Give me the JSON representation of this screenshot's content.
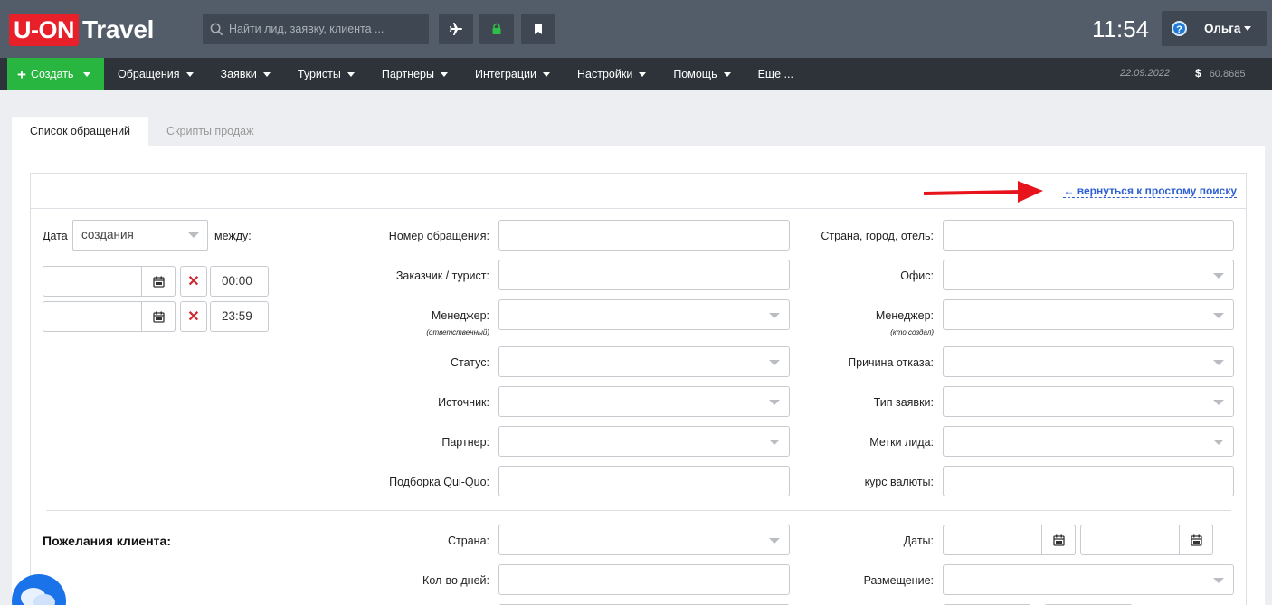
{
  "header": {
    "logo_brand": "U-ON",
    "logo_suffix": "Travel",
    "search_placeholder": "Найти лид, заявку, клиента ...",
    "clock": "11:54",
    "user_name": "Ольга",
    "user_icon_glyph": "?",
    "icons": [
      "search-icon",
      "airplane-icon",
      "lock-icon",
      "bookmark-icon",
      "help-icon"
    ]
  },
  "nav": {
    "create_label": "Создать",
    "items": [
      "Обращения",
      "Заявки",
      "Туристы",
      "Партнеры",
      "Интеграции",
      "Настройки",
      "Помощь",
      "Еще ..."
    ],
    "date": "22.09.2022",
    "currency_symbol": "$",
    "rate": "60.8685"
  },
  "tabs": [
    {
      "label": "Список обращений",
      "active": true
    },
    {
      "label": "Скрипты продаж",
      "active": false
    }
  ],
  "form": {
    "back_link": "← вернуться к простому поиску",
    "date_label": "Дата",
    "date_type": "создания",
    "between_label": "между:",
    "time_from": "00:00",
    "time_to": "23:59",
    "mid_labels": {
      "number": "Номер обращения:",
      "customer": "Заказчик / турист:",
      "manager": "Менеджер:",
      "manager_sub": "(ответственный)",
      "status": "Статус:",
      "source": "Источник:",
      "partner": "Партнер:",
      "quiquo": "Подборка Qui-Quo:"
    },
    "right_labels": {
      "place": "Страна, город, отель:",
      "office": "Офис:",
      "manager": "Менеджер:",
      "manager_sub": "(кто создал)",
      "reject": "Причина отказа:",
      "order_type": "Тип заявки:",
      "tags": "Метки лида:",
      "currency": "курс валюты:"
    },
    "wishes_title": "Пожелания клиента:",
    "wishes_labels": {
      "country": "Страна:",
      "days": "Кол-во дней:",
      "dates": "Даты:",
      "accommodation": "Размещение:"
    }
  },
  "colors": {
    "topbar": "#525d69",
    "navbar": "#2d3339",
    "create": "#28b640",
    "logo": "#e8202a",
    "link": "#2d5fd1",
    "arrow": "#e8141b"
  }
}
